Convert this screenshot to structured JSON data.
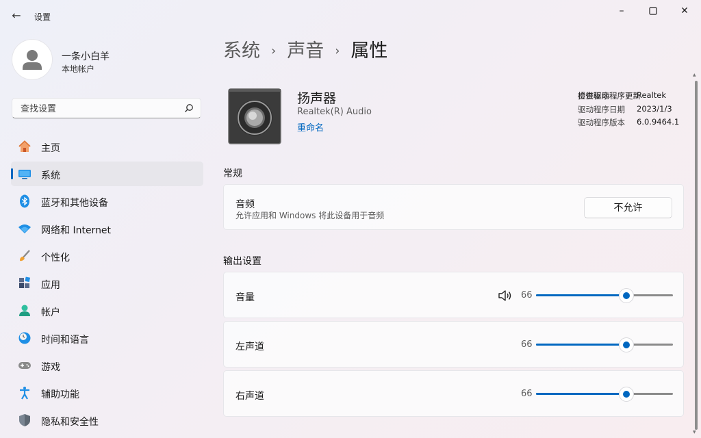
{
  "window": {
    "title": "设置",
    "back_icon": "back-arrow-icon",
    "controls": [
      "minimize-icon",
      "maximize-icon",
      "close-icon"
    ]
  },
  "user": {
    "name": "一条小白羊",
    "account_type": "本地帐户"
  },
  "search": {
    "placeholder": "查找设置",
    "value": ""
  },
  "sidebar": {
    "items": [
      {
        "label": "主页",
        "icon": "home-icon"
      },
      {
        "label": "系统",
        "icon": "system-icon",
        "selected": true
      },
      {
        "label": "蓝牙和其他设备",
        "icon": "bluetooth-icon"
      },
      {
        "label": "网络和 Internet",
        "icon": "wifi-icon"
      },
      {
        "label": "个性化",
        "icon": "brush-icon"
      },
      {
        "label": "应用",
        "icon": "apps-icon"
      },
      {
        "label": "帐户",
        "icon": "account-icon"
      },
      {
        "label": "时间和语言",
        "icon": "clock-globe-icon"
      },
      {
        "label": "游戏",
        "icon": "gamepad-icon"
      },
      {
        "label": "辅助功能",
        "icon": "accessibility-icon"
      },
      {
        "label": "隐私和安全性",
        "icon": "shield-icon"
      }
    ]
  },
  "breadcrumb": {
    "items": [
      "系统",
      "声音",
      "属性"
    ],
    "separator": "›"
  },
  "device": {
    "name": "扬声器",
    "driver_name": "Realtek(R) Audio",
    "rename_link": "重命名",
    "icon": "speaker-icon",
    "info": [
      {
        "key": "提供程序",
        "value": "Realtek"
      },
      {
        "key": "驱动程序日期",
        "value": "2023/1/3"
      },
      {
        "key": "驱动程序版本",
        "value": "6.0.9464.1"
      }
    ],
    "update_driver_link": "检查驱动程序更新"
  },
  "general": {
    "section_title": "常规",
    "audio_label": "音频",
    "audio_desc": "允许应用和 Windows 将此设备用于音频",
    "deny_button": "不允许"
  },
  "output": {
    "section_title": "输出设置",
    "volume": {
      "label": "音量",
      "value": "66",
      "icon": "speaker-volume-icon"
    },
    "left": {
      "label": "左声道",
      "value": "66"
    },
    "right": {
      "label": "右声道",
      "value": "66"
    }
  },
  "colors": {
    "accent": "#0067c0"
  }
}
